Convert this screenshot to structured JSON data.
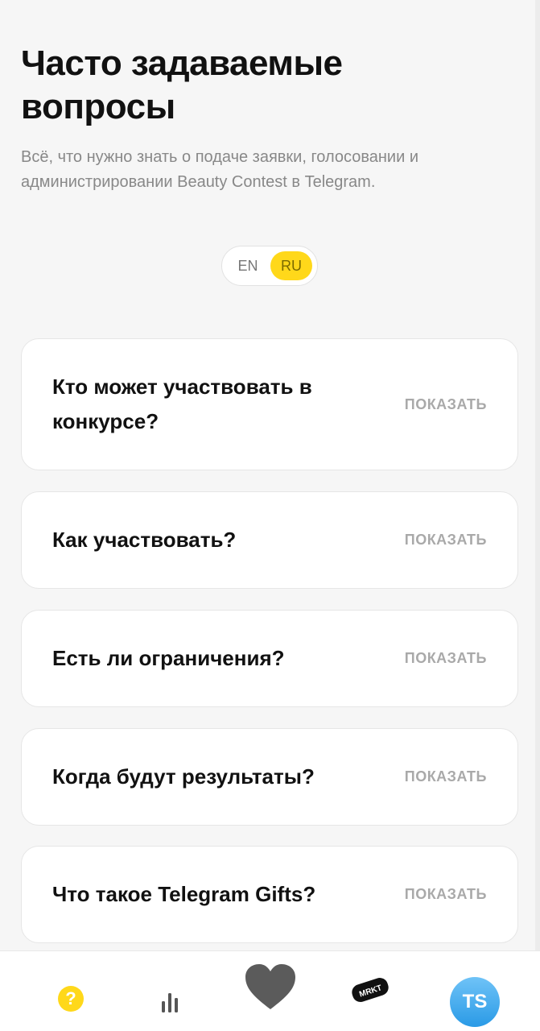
{
  "header": {
    "title": "Часто задаваемые вопросы",
    "subtitle": "Всё, что нужно знать о подаче заявки, голосовании и администрировании Beauty Contest в Telegram."
  },
  "language": {
    "options": [
      "EN",
      "RU"
    ],
    "selected": "RU"
  },
  "faq": {
    "items": [
      {
        "question": "Кто может участвовать в конкурсе?",
        "toggle": "ПОКАЗАТЬ"
      },
      {
        "question": "Как участвовать?",
        "toggle": "ПОКАЗАТЬ"
      },
      {
        "question": "Есть ли ограничения?",
        "toggle": "ПОКАЗАТЬ"
      },
      {
        "question": "Когда будут результаты?",
        "toggle": "ПОКАЗАТЬ"
      },
      {
        "question": "Что такое Telegram Gifts?",
        "toggle": "ПОКАЗАТЬ"
      }
    ]
  },
  "nav": {
    "help_glyph": "?",
    "market_label": "MRKT",
    "avatar_initials": "TS",
    "icons": [
      "help-icon",
      "stats-icon",
      "heart-icon",
      "market-icon",
      "avatar"
    ]
  },
  "colors": {
    "accent": "#ffd81a",
    "heart": "#5b5b5b",
    "avatar": "#2a9ae6"
  }
}
